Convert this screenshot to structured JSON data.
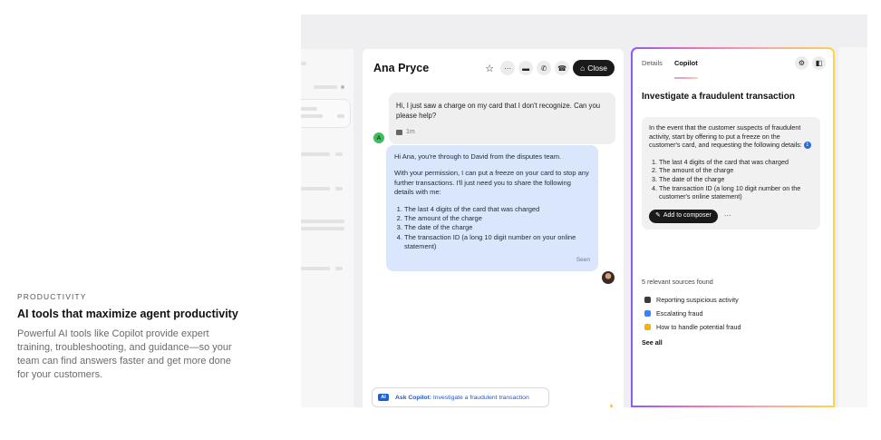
{
  "promo": {
    "eyebrow": "PRODUCTIVITY",
    "title": "AI tools that maximize agent productivity",
    "body": "Powerful AI tools like Copilot provide expert training, troubleshooting, and guidance—so your team can find answers faster and get more done for your customers."
  },
  "conversation": {
    "customer_name": "Ana Pryce",
    "close_label": "Close",
    "icons": [
      "star-icon",
      "more-icon",
      "card-icon",
      "phone-icon",
      "call-icon"
    ],
    "customer_message": {
      "text": "Hi, I just saw a charge on my card that I don't recognize. Can you please help?",
      "time": "1m",
      "avatar_initial": "A"
    },
    "agent_message": {
      "p1": "Hi Ana, you're through to David from the disputes team.",
      "p2": "With your permission, I can put a freeze on your card to stop any further transactions. I'll just need you to share the following details with me:",
      "items": [
        "The last 4 digits of the card that was charged",
        "The amount of the charge",
        "The date of the charge",
        "The transaction ID (a long 10 digit number on your online statement)"
      ],
      "status": "Seen"
    },
    "ask_copilot": {
      "chip": "AI",
      "prefix": "Ask Copilot:",
      "query": "Investigate a fraudulent transaction"
    }
  },
  "copilot": {
    "tabs": [
      "Details",
      "Copilot"
    ],
    "active_tab": "Copilot",
    "title": "Investigate a fraudulent transaction",
    "intro": "In the event that the customer suspects of fraudulent activity, start by offering to put a freeze on the customer's card, and requesting the following details:",
    "info_marker": "1",
    "items": [
      "The last 4 digits of the card that was charged",
      "The amount of the charge",
      "The date of the charge",
      "The transaction ID (a long 10 digit number on the customer's online statement)"
    ],
    "add_label": "Add to composer",
    "more_label": "···",
    "sources_heading": "5 relevant sources found",
    "sources": [
      {
        "label": "Reporting suspicious activity",
        "color": "#3a3a3a"
      },
      {
        "label": "Escalating fraud",
        "color": "#3b82f6"
      },
      {
        "label": "How to handle potential fraud",
        "color": "#f5b301"
      }
    ],
    "see_all": "See all"
  },
  "colors": {
    "accent_blue": "#2457c5",
    "agent_bubble": "#d9e6fb",
    "dark_button": "#1a1a1a"
  }
}
